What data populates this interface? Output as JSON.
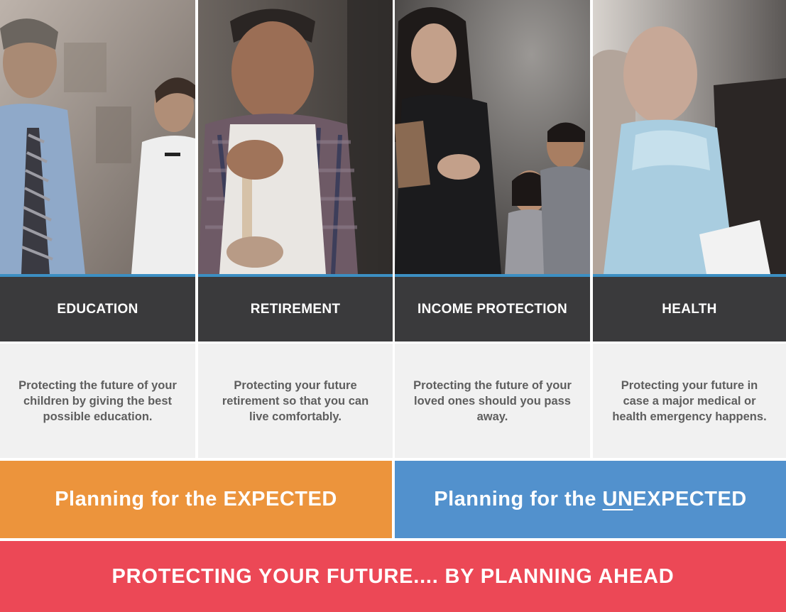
{
  "categories": [
    {
      "title": "EDUCATION",
      "description": "Protecting the future of your children by giving the best possible education."
    },
    {
      "title": "RETIREMENT",
      "description": "Protecting your future retirement so that you can live comfortably."
    },
    {
      "title": "INCOME PROTECTION",
      "description": "Protecting the future of your loved ones should you pass away."
    },
    {
      "title": "HEALTH",
      "description": "Protecting your future in case a major medical or health emergency happens."
    }
  ],
  "banners": {
    "expected": "Planning for the EXPECTED",
    "unexpected_prefix": "Planning for the ",
    "unexpected_underlined": "UN",
    "unexpected_suffix": "EXPECTED"
  },
  "footer": "PROTECTING YOUR FUTURE.... BY PLANNING AHEAD",
  "colors": {
    "header_bg": "#3a3a3c",
    "desc_bg": "#f1f1f1",
    "accent_line": "#3c8fc3",
    "expected_orange": "#ec943c",
    "unexpected_blue": "#5291cd",
    "footer_red": "#ec4856"
  },
  "photos": [
    "father-and-son-photo",
    "elderly-baker-photo",
    "mother-with-children-photo",
    "hospital-patient-photo"
  ]
}
